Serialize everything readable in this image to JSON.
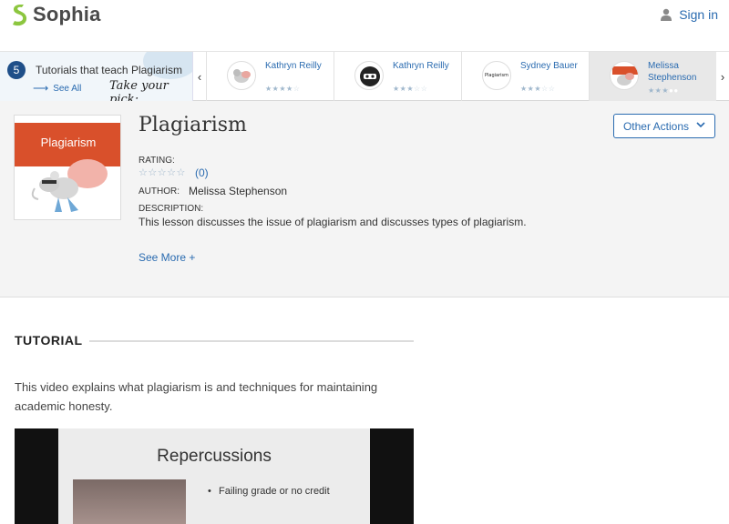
{
  "brand": {
    "name": "Sophia"
  },
  "header": {
    "signin_label": "Sign in"
  },
  "carousel": {
    "count": "5",
    "title": "Tutorials that teach Plagiarism",
    "see_all": "See All",
    "pick_text": "Take your pick:",
    "items": [
      {
        "author": "Kathryn Reilly",
        "rating": 4
      },
      {
        "author": "Kathryn Reilly",
        "rating": 3
      },
      {
        "author": "Sydney Bauer",
        "rating": 3,
        "thumb_text": "Plagiarism"
      },
      {
        "author": "Melissa Stephenson",
        "rating": 3,
        "active": true
      }
    ]
  },
  "lesson": {
    "title": "Plagiarism",
    "thumb_banner": "Plagiarism",
    "rating_label": "RATING:",
    "rating_count": "(0)",
    "author_label": "AUTHOR:",
    "author": "Melissa Stephenson",
    "description_label": "DESCRIPTION:",
    "description": "This lesson discusses the issue of plagiarism and discusses types of plagiarism.",
    "see_more": "See More +",
    "other_actions": "Other Actions"
  },
  "tutorial": {
    "heading": "TUTORIAL",
    "text": "This video explains what plagiarism is and techniques for maintaining academic honesty.",
    "video": {
      "slide_title": "Repercussions",
      "bullet": "Failing grade or no credit"
    }
  },
  "colors": {
    "accent": "#2a6bb0",
    "brand_green": "#8cc63f",
    "badge": "#1f4f89",
    "banner": "#d9502b"
  }
}
